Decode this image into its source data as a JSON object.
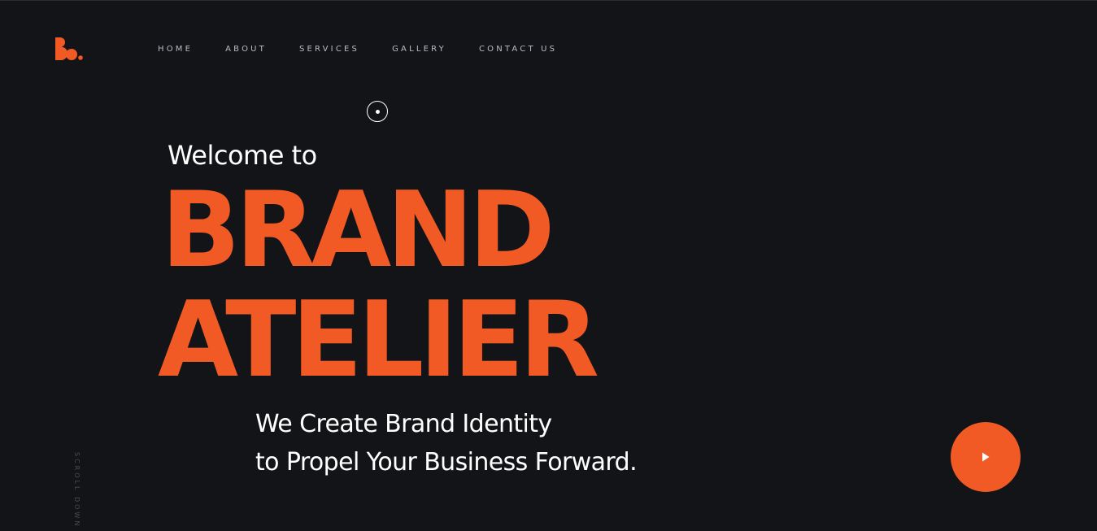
{
  "brand": {
    "logo_icon": "ba-monogram-logo",
    "accent_color": "#f15a24",
    "background_color": "#131418"
  },
  "nav": {
    "items": [
      {
        "label": "HOME"
      },
      {
        "label": "ABOUT"
      },
      {
        "label": "SERVICES"
      },
      {
        "label": "GALLERY"
      },
      {
        "label": "CONTACT US"
      }
    ]
  },
  "hero": {
    "welcome": "Welcome to",
    "title_line1": "BRAND",
    "title_line2": "ATELIER",
    "tagline_line1": "We Create Brand Identity",
    "tagline_line2": "to Propel Your Business Forward."
  },
  "scroll_hint": "SCROLL DOWN",
  "play_button": {
    "icon": "play-icon"
  }
}
